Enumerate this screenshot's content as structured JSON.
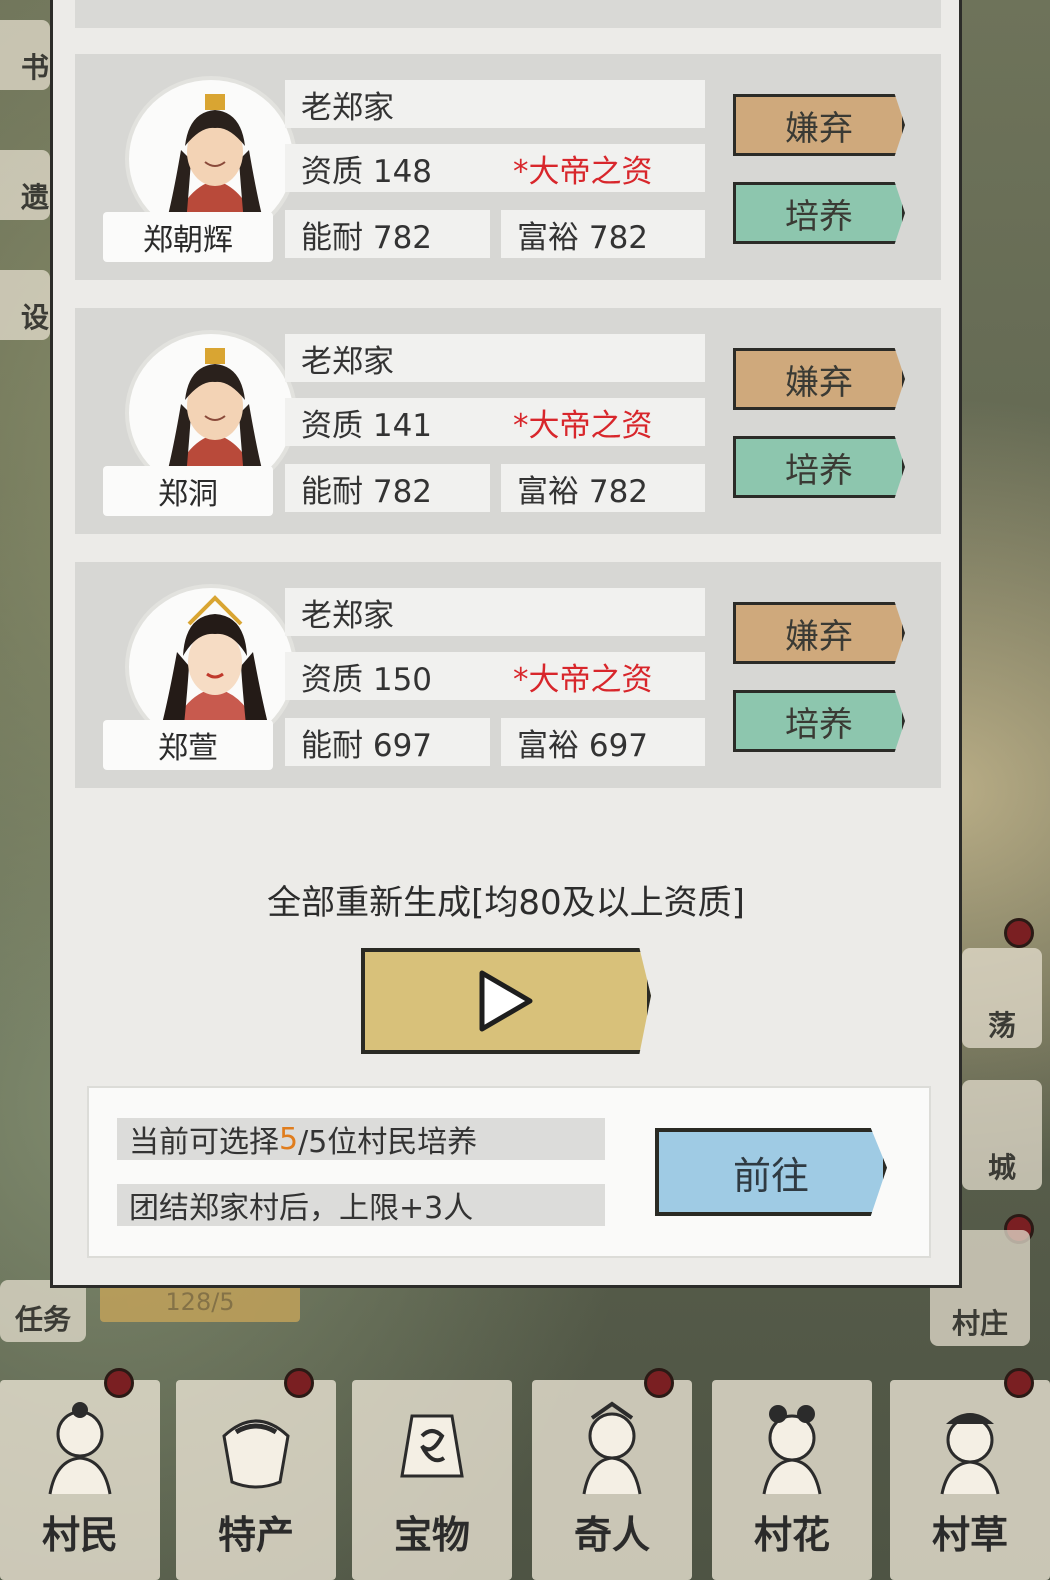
{
  "side_left": {
    "top_chars": [
      "书",
      "遗",
      "设"
    ],
    "task_label": "任务",
    "counter": "128/5"
  },
  "side_right": [
    "荡",
    "城",
    "村庄"
  ],
  "cards": [
    {
      "name": "郑朝辉",
      "family": "老郑家",
      "quality": "资质 148",
      "quality_tag": "*大帝之资",
      "ability": "能耐 782",
      "wealth": "富裕 782",
      "discard_label": "嫌弃",
      "train_label": "培养",
      "portrait": "male-avatar-icon"
    },
    {
      "name": "郑洞",
      "family": "老郑家",
      "quality": "资质 141",
      "quality_tag": "*大帝之资",
      "ability": "能耐 782",
      "wealth": "富裕 782",
      "discard_label": "嫌弃",
      "train_label": "培养",
      "portrait": "male-avatar-icon"
    },
    {
      "name": "郑萱",
      "family": "老郑家",
      "quality": "资质 150",
      "quality_tag": "*大帝之资",
      "ability": "能耐 697",
      "wealth": "富裕 697",
      "discard_label": "嫌弃",
      "train_label": "培养",
      "portrait": "female-avatar-icon"
    }
  ],
  "regenerate": {
    "text": "全部重新生成[均80及以上资质]",
    "button_icon": "play-icon"
  },
  "info": {
    "line1_prefix": "当前可选择",
    "line1_count": "5",
    "line1_suffix": "/5位村民培养",
    "line2": "团结郑家村后，上限+3人",
    "goto_label": "前往"
  },
  "bottom_nav": [
    {
      "label": "村民",
      "icon": "villager-icon"
    },
    {
      "label": "特产",
      "icon": "specialty-icon"
    },
    {
      "label": "宝物",
      "icon": "treasure-icon"
    },
    {
      "label": "奇人",
      "icon": "stranger-icon"
    },
    {
      "label": "村花",
      "icon": "village-belle-icon"
    },
    {
      "label": "村草",
      "icon": "village-beau-icon"
    }
  ],
  "colors": {
    "accent_red": "#d8262b",
    "count_orange": "#e07d1d",
    "discard_btn": "#cfa97c",
    "train_btn": "#8dc6ae",
    "goto_btn": "#9fcbe4",
    "play_btn": "#d8c17a"
  }
}
